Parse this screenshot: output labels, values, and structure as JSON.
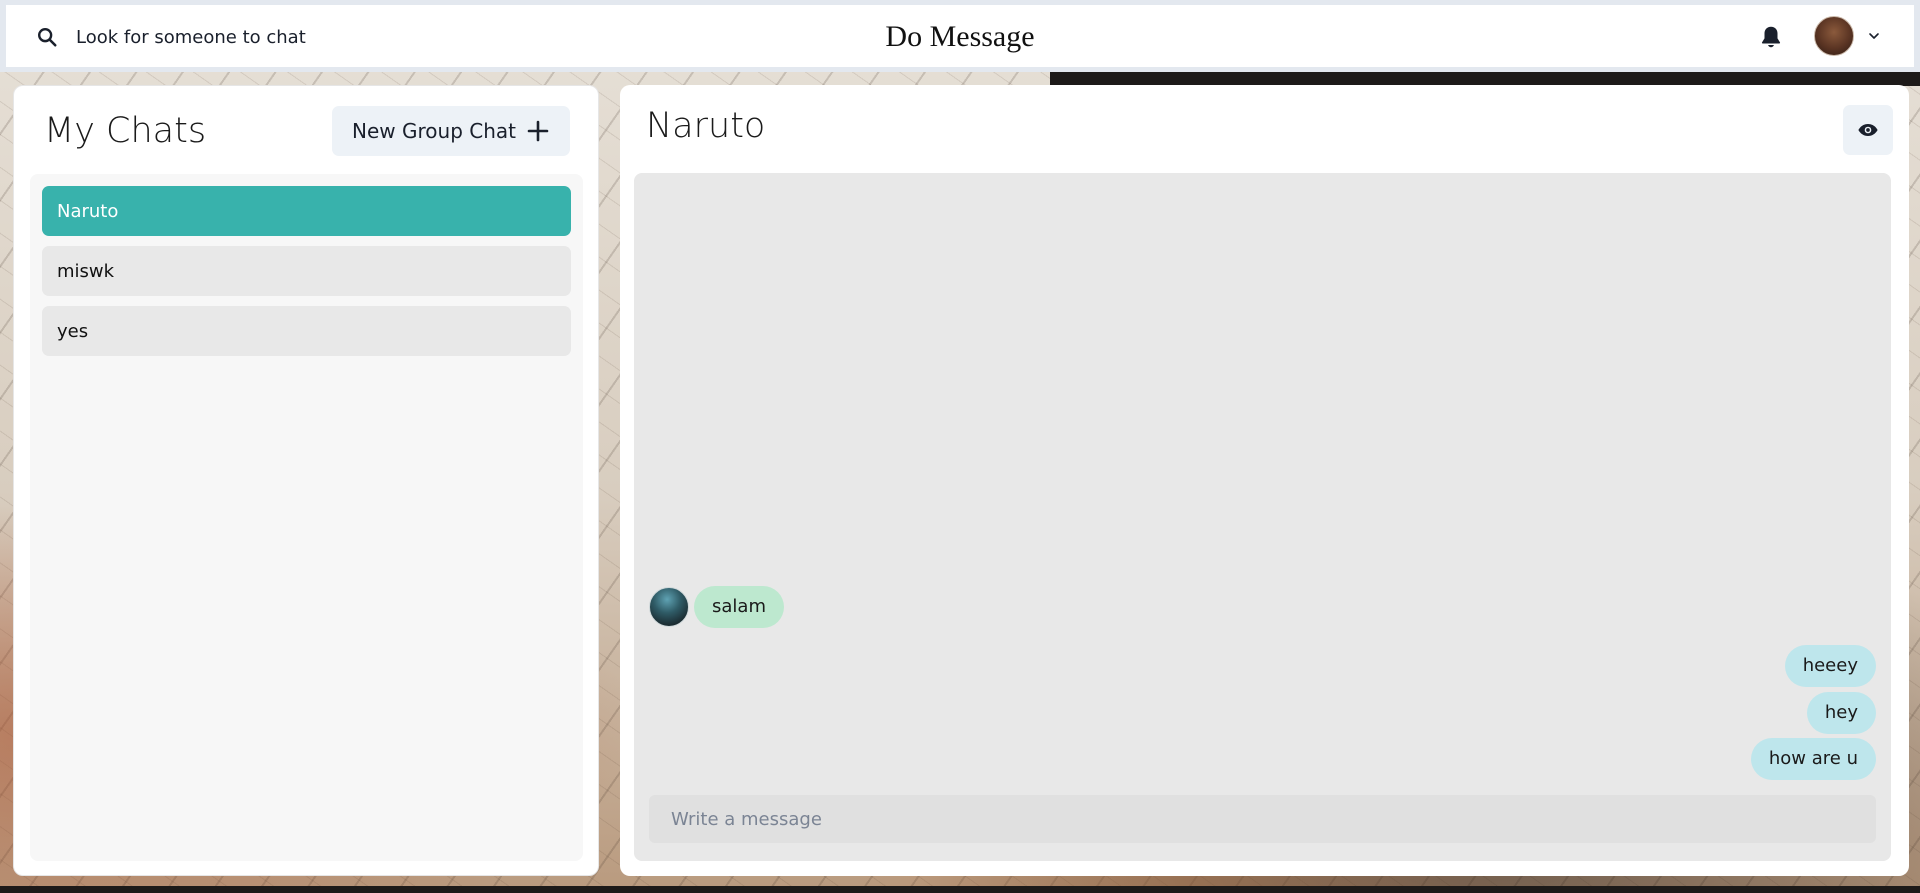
{
  "header": {
    "search_label": "Look for someone to chat",
    "app_title": "Do Message",
    "icons": {
      "search": "search-icon",
      "notifications": "bell-icon",
      "profile_menu": "chevron-down-icon"
    }
  },
  "sidebar": {
    "title": "My Chats",
    "new_group_label": "New Group Chat",
    "chats": [
      {
        "name": "Naruto",
        "active": true
      },
      {
        "name": "miswk",
        "active": false
      },
      {
        "name": "yes",
        "active": false
      }
    ]
  },
  "chat": {
    "title": "Naruto",
    "messages": [
      {
        "text": "salam",
        "direction": "incoming"
      },
      {
        "text": "heeey",
        "direction": "outgoing"
      },
      {
        "text": "hey",
        "direction": "outgoing"
      },
      {
        "text": "how are u",
        "direction": "outgoing"
      }
    ],
    "input_placeholder": "Write a message"
  },
  "colors": {
    "active_chat": "#38b2ac",
    "incoming_bubble": "#bde8cf",
    "outgoing_bubble": "#bee6ec"
  }
}
